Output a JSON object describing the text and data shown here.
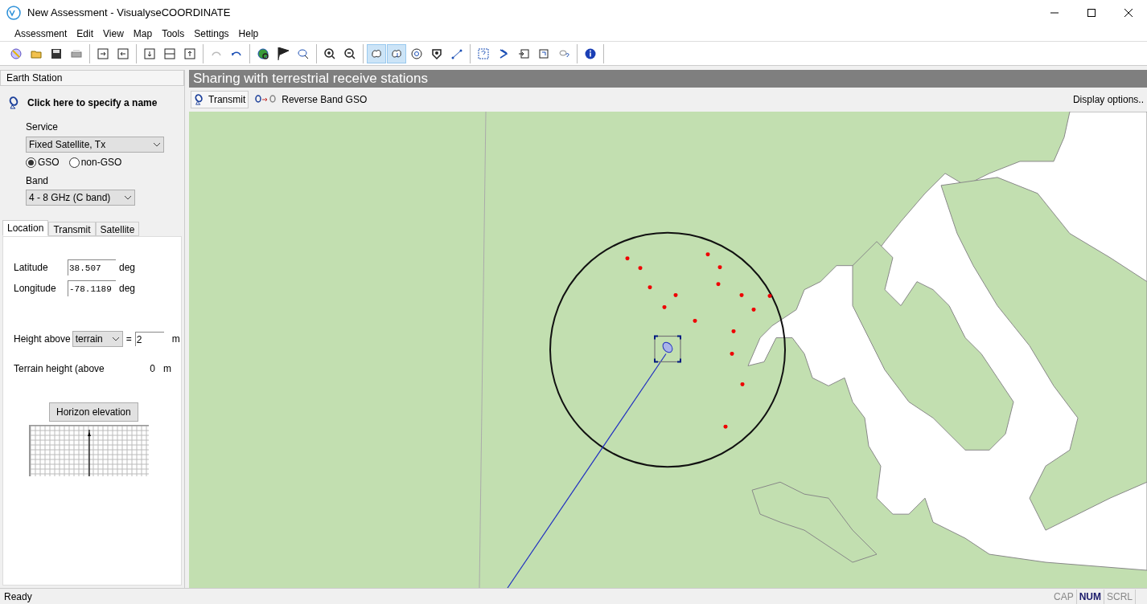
{
  "window": {
    "title": "New Assessment - VisualyseCOORDINATE"
  },
  "menu": [
    "Assessment",
    "Edit",
    "View",
    "Map",
    "Tools",
    "Settings",
    "Help"
  ],
  "toolbar": [
    [
      {
        "selected": false
      },
      {
        "selected": false
      },
      {
        "selected": false
      },
      {
        "selected": false
      }
    ],
    [
      {
        "selected": false
      },
      {
        "selected": false
      }
    ],
    [
      {
        "selected": false
      },
      {
        "selected": false
      },
      {
        "selected": false
      }
    ],
    [
      {
        "selected": false
      },
      {
        "selected": false
      }
    ],
    [
      {
        "selected": false
      },
      {
        "selected": false
      },
      {
        "selected": false
      }
    ],
    [
      {
        "selected": false
      },
      {
        "selected": false
      }
    ],
    [
      {
        "selected": true
      },
      {
        "selected": true
      },
      {
        "selected": false
      },
      {
        "selected": false
      },
      {
        "selected": false
      }
    ],
    [
      {
        "selected": false
      },
      {
        "selected": false
      },
      {
        "selected": false
      },
      {
        "selected": false
      },
      {
        "selected": false
      }
    ],
    [
      {
        "selected": false
      }
    ]
  ],
  "sidebar": {
    "header": "Earth Station",
    "name_prompt": "Click here to specify a name",
    "service": {
      "label": "Service",
      "value": "Fixed Satellite, Tx"
    },
    "orbit": [
      {
        "label": "GSO",
        "selected": true
      },
      {
        "label": "non-GSO",
        "selected": false
      }
    ],
    "band": {
      "label": "Band",
      "value": "4 - 8 GHz (C band)"
    },
    "tabs": [
      {
        "label": "Location",
        "selected": true
      },
      {
        "label": "Transmit",
        "selected": false
      },
      {
        "label": "Satellite",
        "selected": false
      }
    ],
    "latitude": {
      "label": "Latitude",
      "value": "38.507",
      "unit": "deg"
    },
    "longitude": {
      "label": "Longitude",
      "value": "-78.1189",
      "unit": "deg"
    },
    "height": {
      "label": "Height above",
      "reference": "terrain",
      "equals": "=",
      "value": "2",
      "unit": "m"
    },
    "terrain": {
      "label": "Terrain height (above",
      "value": "0",
      "unit": "m"
    },
    "horizon_button": "Horizon elevation"
  },
  "main": {
    "title": "Sharing with terrestrial receive stations",
    "modes": [
      {
        "label": "Transmit",
        "selected": true
      },
      {
        "label": "Reverse Band GSO",
        "selected": false
      }
    ],
    "display_options": "Display options.."
  },
  "status_bar": {
    "text": "Ready",
    "indicators": [
      {
        "label": "CAP",
        "on": false
      },
      {
        "label": "NUM",
        "on": true
      },
      {
        "label": "SCRL",
        "on": false
      }
    ]
  }
}
